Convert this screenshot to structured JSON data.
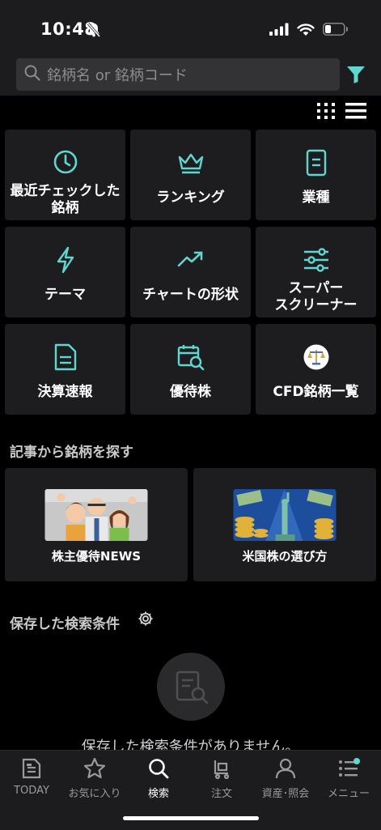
{
  "status": {
    "time": "10:48"
  },
  "search": {
    "placeholder": "銘柄名 or 銘柄コード"
  },
  "tiles": [
    {
      "label": "最近チェックした\n銘柄",
      "icon": "clock-icon"
    },
    {
      "label": "ランキング",
      "icon": "crown-icon"
    },
    {
      "label": "業種",
      "icon": "document-icon"
    },
    {
      "label": "テーマ",
      "icon": "lightning-icon"
    },
    {
      "label": "チャートの形状",
      "icon": "trend-icon"
    },
    {
      "label": "スーパー\nスクリーナー",
      "icon": "sliders-icon"
    },
    {
      "label": "決算速報",
      "icon": "report-icon"
    },
    {
      "label": "優待株",
      "icon": "calendar-search-icon"
    },
    {
      "label": "CFD銘柄一覧",
      "icon": "scale-icon"
    }
  ],
  "articles": {
    "title": "記事から銘柄を探す",
    "items": [
      {
        "label": "株主優待NEWS"
      },
      {
        "label": "米国株の選び方"
      }
    ]
  },
  "saved": {
    "title": "保存した検索条件",
    "empty_text": "保存した検索条件がありません。"
  },
  "tabbar": [
    {
      "label": "TODAY",
      "icon": "newspaper-icon"
    },
    {
      "label": "お気に入り",
      "icon": "star-icon"
    },
    {
      "label": "検索",
      "icon": "search-icon",
      "active": true
    },
    {
      "label": "注文",
      "icon": "cart-icon"
    },
    {
      "label": "資産･照会",
      "icon": "person-icon"
    },
    {
      "label": "メニュー",
      "icon": "menu-icon"
    }
  ],
  "colors": {
    "accent": "#5fd6d0",
    "background": "#000000",
    "tile": "#1d1d1f"
  }
}
